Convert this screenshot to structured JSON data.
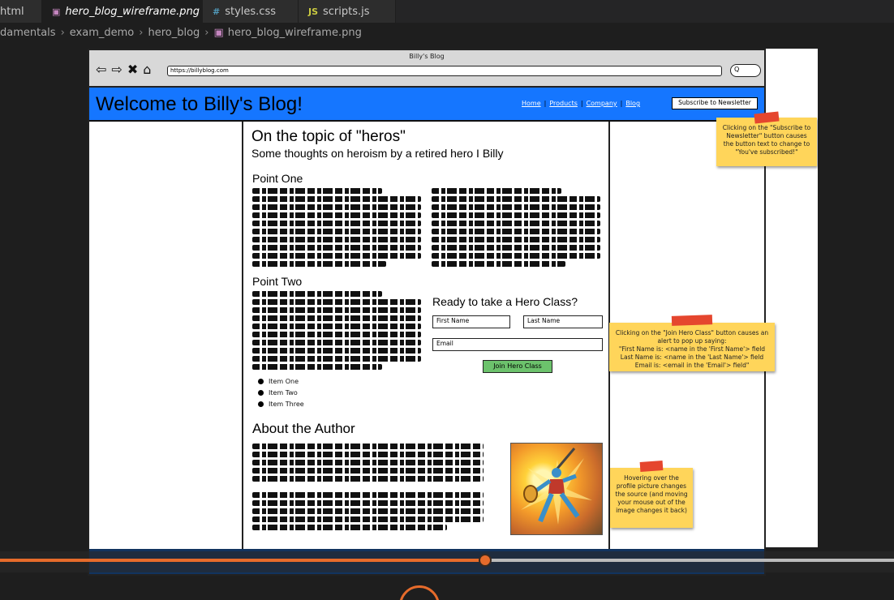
{
  "editor": {
    "tabs": [
      {
        "label": "html",
        "icon": "",
        "active": false
      },
      {
        "label": "hero_blog_wireframe.png",
        "icon": "image-icon",
        "active": true
      },
      {
        "label": "styles.css",
        "icon": "#",
        "active": false
      },
      {
        "label": "scripts.js",
        "icon": "JS",
        "active": false
      }
    ],
    "close_glyph": "✕",
    "breadcrumb": [
      "damentals",
      "exam_demo",
      "hero_blog",
      "hero_blog_wireframe.png"
    ]
  },
  "browser": {
    "title": "Billy's Blog",
    "url": "https://billyblog.com",
    "search": "Q"
  },
  "site": {
    "heading": "Welcome to Billy's Blog!",
    "nav": [
      "Home",
      "Products",
      "Company",
      "Blog"
    ],
    "subscribe_label": "Subscribe to Newsletter",
    "article": {
      "title": "On the topic of \"heros\"",
      "subtitle": "Some thoughts on heroism by a retired hero I Billy",
      "point_one": "Point One",
      "point_two": "Point Two",
      "list_items": [
        "Item One",
        "Item Two",
        "Item Three"
      ],
      "about": "About the Author"
    },
    "form": {
      "heading": "Ready to take a Hero Class?",
      "first_name": "First Name",
      "last_name": "Last Name",
      "email": "Email",
      "join_label": "Join Hero Class"
    }
  },
  "notes": {
    "subscribe": "Clicking on the \"Subscribe to Newsletter\" button causes the button text to change to \"You've subscribed!\"",
    "join_line1": "Clicking on the \"Join Hero Class\" button causes an alert to pop up saying:",
    "join_line2": "\"First Name is: <name in the 'First Name'> field",
    "join_line3": "Last Name is: <name in the 'Last Name'> field",
    "join_line4": "Email is: <email in the 'Email'> field\"",
    "hover": "Hovering over the profile picture changes the source (and moving your mouse out of the image changes it back)"
  },
  "colors": {
    "hero_blue": "#1576ff",
    "sticky_yellow": "#ffd55a",
    "tape_red": "#e5462e",
    "join_green": "#6cc26c",
    "progress_orange": "#e66b2b"
  },
  "player": {
    "progress": 0.543
  }
}
